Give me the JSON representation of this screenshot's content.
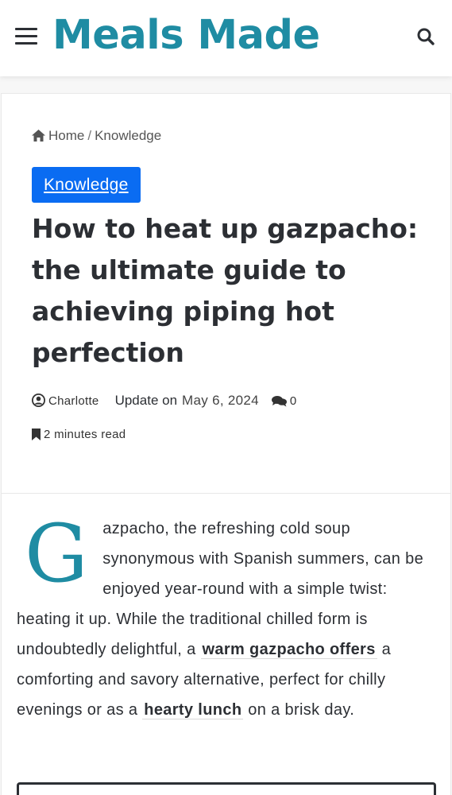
{
  "site": {
    "logo": "Meals Made",
    "brand_color": "#1f8ca3",
    "menu_icon": "hamburger-menu-icon",
    "search_icon": "search-icon"
  },
  "breadcrumb": {
    "home": "Home",
    "separator": "/",
    "current": "Knowledge"
  },
  "post": {
    "category": "Knowledge",
    "category_color": "#0a6cf2",
    "title": "How to heat up gazpacho: the ultimate guide to achieving piping hot perfection",
    "author": "Charlotte",
    "update_label": "Update on",
    "date": "May 6, 2024",
    "comments": "0",
    "read_time": "2 minutes read"
  },
  "article": {
    "dropcap": "G",
    "text_1": "azpacho, the refreshing cold soup synonymous with Spanish summers, can be enjoyed year-round with a simple twist: heating it up. While the traditional chilled form is undoubtedly delightful, a ",
    "link_1": "warm gazpacho offers",
    "text_2": " a comforting and savory alternative, perfect for chilly evenings or as a ",
    "link_2": "hearty lunch",
    "text_3": " on a brisk day."
  }
}
